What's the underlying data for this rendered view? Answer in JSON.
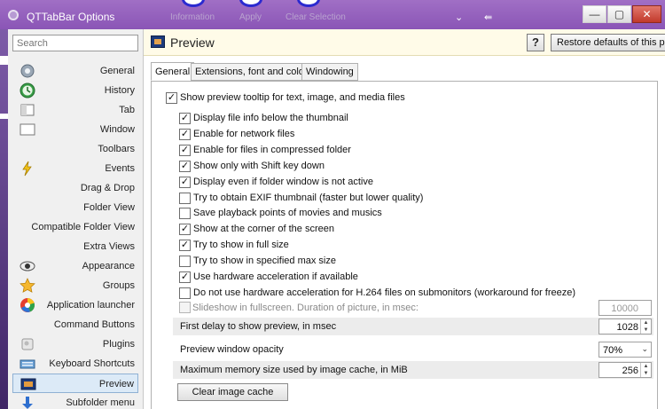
{
  "window": {
    "title": "QTTabBar Options",
    "ghost_texts": [
      "Information",
      "Apply",
      "Apply",
      "Clear Selection"
    ],
    "controls": {
      "chevron": "⌄",
      "pin": "⇚",
      "minimize": "—",
      "maximize": "▢",
      "close": "✕"
    }
  },
  "sidebar": {
    "search_placeholder": "Search",
    "items": [
      {
        "label": "General",
        "icon": "gear-icon"
      },
      {
        "label": "History",
        "icon": "history-icon"
      },
      {
        "label": "Tab",
        "icon": "tab-icon"
      },
      {
        "label": "Window",
        "icon": "window-icon"
      },
      {
        "label": "Toolbars",
        "icon": "toolbars-icon"
      },
      {
        "label": "Events",
        "icon": "lightning-icon"
      },
      {
        "label": "Drag & Drop",
        "icon": "drag-drop-icon"
      },
      {
        "label": "Folder View",
        "icon": "folder-view-icon"
      },
      {
        "label": "Compatible Folder View",
        "icon": "compatible-folder-view-icon"
      },
      {
        "label": "Extra Views",
        "icon": "extra-views-icon"
      },
      {
        "label": "Appearance",
        "icon": "eye-icon"
      },
      {
        "label": "Groups",
        "icon": "star-icon"
      },
      {
        "label": "Application launcher",
        "icon": "launcher-icon"
      },
      {
        "label": "Command Buttons",
        "icon": "command-buttons-icon"
      },
      {
        "label": "Plugins",
        "icon": "plugins-icon"
      },
      {
        "label": "Keyboard Shortcuts",
        "icon": "keyboard-icon"
      },
      {
        "label": "Preview",
        "icon": "preview-icon",
        "selected": true
      },
      {
        "label": "Subfolder menu",
        "icon": "subfolder-icon"
      }
    ]
  },
  "header": {
    "title": "Preview",
    "help_label": "?",
    "restore_label": "Restore defaults of this page"
  },
  "tabs": [
    {
      "label": "General",
      "active": true
    },
    {
      "label": "Extensions, font and color",
      "active": false
    },
    {
      "label": "Windowing",
      "active": false
    }
  ],
  "options": {
    "master": {
      "label": "Show preview tooltip for text, image, and media files",
      "checked": true
    },
    "items": [
      {
        "label": "Display file info below the thumbnail",
        "checked": true
      },
      {
        "label": "Enable for network files",
        "checked": true
      },
      {
        "label": "Enable for files in compressed folder",
        "checked": true
      },
      {
        "label": "Show only with Shift key down",
        "checked": true
      },
      {
        "label": "Display even if folder window is not active",
        "checked": true
      },
      {
        "label": "Try to obtain EXIF thumbnail (faster but lower quality)",
        "checked": false
      },
      {
        "label": "Save playback points of movies and musics",
        "checked": false
      },
      {
        "label": "Show at the corner of the screen",
        "checked": true
      },
      {
        "label": "Try to show in full size",
        "checked": true
      },
      {
        "label": "Try to show in specified max size",
        "checked": false
      },
      {
        "label": "Use hardware acceleration if available",
        "checked": true
      },
      {
        "label": "Do not use hardware acceleration for H.264 files  on submonitors (workaround for freeze)",
        "checked": false
      }
    ]
  },
  "settings": {
    "slideshow": {
      "label": "Slideshow in fullscreen. Duration of picture, in msec:",
      "value": "10000",
      "checked": false,
      "disabled": true
    },
    "first_delay": {
      "label": "First delay to show preview, in msec",
      "value": "1028"
    },
    "opacity": {
      "label": "Preview window opacity",
      "value": "70%"
    },
    "max_memory": {
      "label": "Maximum memory size used by image cache, in MiB",
      "value": "256"
    }
  },
  "clear_cache_label": "Clear image cache",
  "colors": {
    "accent": "#8a55b6",
    "header_bg": "#fffbe8",
    "selected_bg": "#dceaf7"
  }
}
